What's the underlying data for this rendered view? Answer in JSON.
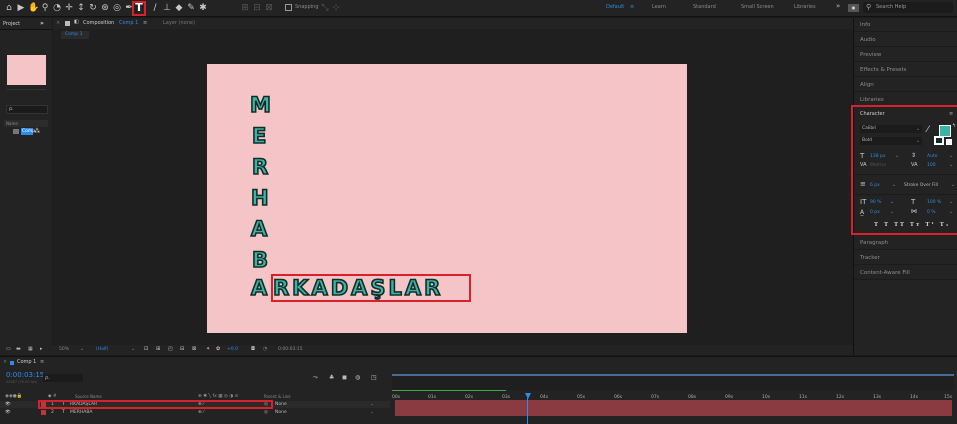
{
  "toolbar": {
    "snapping_label": "Snapping",
    "workspaces": [
      "Default",
      "Learn",
      "Standard",
      "Small Screen",
      "Libraries"
    ],
    "active_workspace": "Default",
    "search_placeholder": "Search Help",
    "accent": "#2d8ceb",
    "highlight": "#d8212b"
  },
  "project_panel": {
    "tab_project": "Project",
    "comp_item": "Comp",
    "name_header": "Name"
  },
  "composition_panel": {
    "tab_label": "Composition",
    "tab_comp": "Comp 1",
    "layer_tab": "Layer (none)",
    "breadcrumb": "Comp 1",
    "zoom": "50%",
    "resolution": "(Half)",
    "exposure": "+0.0",
    "timecode": "0:00:03:15",
    "canvas_color": "#f5c4c6"
  },
  "canvas_text": {
    "vertical_letters": [
      "M",
      "E",
      "R",
      "H",
      "A",
      "B",
      "A"
    ],
    "horizontal_word": "RKADAŞLAR",
    "fill_color": "#3cb3a5",
    "stroke_color": "#0f2d28"
  },
  "right_panel": {
    "items": [
      "Info",
      "Audio",
      "Preview",
      "Effects & Presets",
      "Align",
      "Libraries"
    ],
    "bottom_items": [
      "Paragraph",
      "Tracker",
      "Content-Aware Fill"
    ]
  },
  "character_panel": {
    "title": "Character",
    "font_family": "Calibri",
    "font_style": "Bold",
    "font_size": "138 px",
    "leading": "Auto",
    "kerning": "Metrics",
    "tracking": "100",
    "stroke_width": "6 px",
    "stroke_type": "Stroke Over Fill",
    "vert_scale": "90 %",
    "horiz_scale": "100 %",
    "baseline_shift": "0 px",
    "tsume": "0 %",
    "style_buttons": "T T TT Tт T¹ T₁",
    "fill_swatch": "#3cb3a5"
  },
  "timeline": {
    "tab_label": "Comp 1",
    "timecode": "0:00:03:15",
    "frame_info": "00087 (25.00 fps)",
    "search_icon_label": "ρ.",
    "col_source": "Source Name",
    "col_parent": "Parent & Link",
    "time_markers": [
      "00s",
      "01s",
      "02s",
      "03s",
      "04s",
      "05s",
      "06s",
      "07s",
      "08s",
      "09s",
      "10s",
      "11s",
      "12s",
      "13s",
      "14s",
      "15s"
    ],
    "layers": [
      {
        "num": "1",
        "name": "RKADAŞLAR",
        "parent": "None"
      },
      {
        "num": "2",
        "name": "MERHABA",
        "parent": "None"
      }
    ],
    "playhead_color": "#2d8ceb"
  }
}
